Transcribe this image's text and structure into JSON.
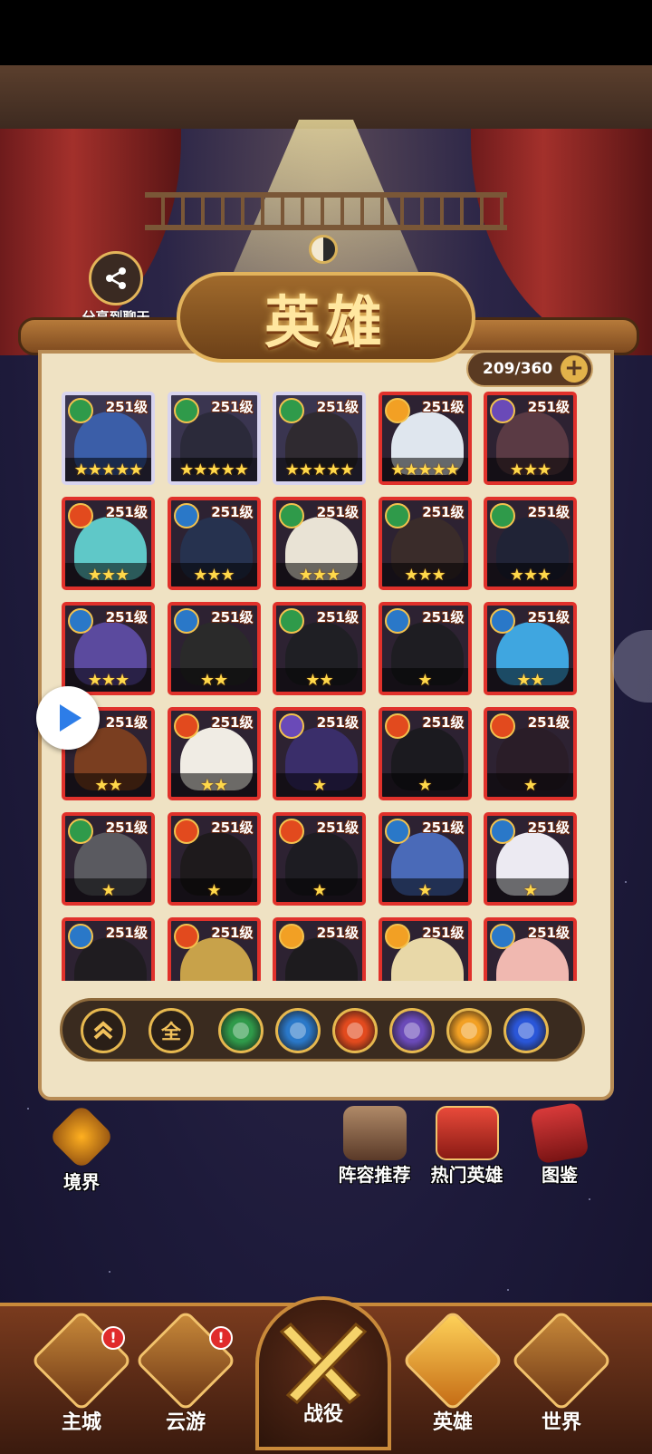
{
  "share": {
    "label": "分享到聊天",
    "icon": "share-icon"
  },
  "header": {
    "title": "英雄"
  },
  "counter": {
    "text": "209/360",
    "plus_label": "+"
  },
  "heroes": [
    {
      "level": "251级",
      "element": "wood",
      "stars": "★★★★★",
      "frame": "platinum",
      "face": "#3b5ea8"
    },
    {
      "level": "251级",
      "element": "wood",
      "stars": "★★★★★",
      "frame": "platinum",
      "face": "#2b2a3a"
    },
    {
      "level": "251级",
      "element": "wood",
      "stars": "★★★★★",
      "frame": "platinum",
      "face": "#2f2a30"
    },
    {
      "level": "251级",
      "element": "light",
      "stars": "★★★★★",
      "frame": "red",
      "face": "#dfe6ee"
    },
    {
      "level": "251级",
      "element": "moon",
      "stars": "★★★",
      "frame": "red",
      "face": "#5a3a44"
    },
    {
      "level": "251级",
      "element": "fire",
      "stars": "★★★",
      "frame": "red",
      "face": "#5fc8c8"
    },
    {
      "level": "251级",
      "element": "water",
      "stars": "★★★",
      "frame": "red",
      "face": "#26324f"
    },
    {
      "level": "251级",
      "element": "wood",
      "stars": "★★★",
      "frame": "red",
      "face": "#e9e3d5"
    },
    {
      "level": "251级",
      "element": "wood",
      "stars": "★★★",
      "frame": "red",
      "face": "#3a2c2a"
    },
    {
      "level": "251级",
      "element": "wood",
      "stars": "★★★",
      "frame": "red",
      "face": "#202336"
    },
    {
      "level": "251级",
      "element": "water",
      "stars": "★★★",
      "frame": "red",
      "face": "#5b4a9e"
    },
    {
      "level": "251级",
      "element": "water",
      "stars": "★★",
      "frame": "red",
      "face": "#2a2a2a"
    },
    {
      "level": "251级",
      "element": "wood",
      "stars": "★★",
      "frame": "red",
      "face": "#1f1f24"
    },
    {
      "level": "251级",
      "element": "water",
      "stars": "★",
      "frame": "red",
      "face": "#1e1d22"
    },
    {
      "level": "251级",
      "element": "water",
      "stars": "★★",
      "frame": "red",
      "face": "#3fa6e0"
    },
    {
      "level": "251级",
      "element": "fire",
      "stars": "★★",
      "frame": "red",
      "face": "#7a3e20"
    },
    {
      "level": "251级",
      "element": "fire",
      "stars": "★★",
      "frame": "red",
      "face": "#f0ece4"
    },
    {
      "level": "251级",
      "element": "moon",
      "stars": "★",
      "frame": "red",
      "face": "#3a2e6a"
    },
    {
      "level": "251级",
      "element": "fire",
      "stars": "★",
      "frame": "red",
      "face": "#1b1a1f"
    },
    {
      "level": "251级",
      "element": "fire",
      "stars": "★",
      "frame": "red",
      "face": "#2a1d28"
    },
    {
      "level": "251级",
      "element": "wood",
      "stars": "★",
      "frame": "red",
      "face": "#5a5a60"
    },
    {
      "level": "251级",
      "element": "fire",
      "stars": "★",
      "frame": "red",
      "face": "#1e1a1c"
    },
    {
      "level": "251级",
      "element": "fire",
      "stars": "★",
      "frame": "red",
      "face": "#1d1c22"
    },
    {
      "level": "251级",
      "element": "water",
      "stars": "★",
      "frame": "red",
      "face": "#4a6ab8"
    },
    {
      "level": "251级",
      "element": "water",
      "stars": "★",
      "frame": "red",
      "face": "#eceaf2"
    },
    {
      "level": "251级",
      "element": "water",
      "stars": "",
      "frame": "red",
      "face": "#1f1c20"
    },
    {
      "level": "251级",
      "element": "fire",
      "stars": "",
      "frame": "red",
      "face": "#c8a24a"
    },
    {
      "level": "251级",
      "element": "light",
      "stars": "",
      "frame": "red",
      "face": "#1d1b1e"
    },
    {
      "level": "251级",
      "element": "light",
      "stars": "",
      "frame": "red",
      "face": "#e8d8a8"
    },
    {
      "level": "251级",
      "element": "water",
      "stars": "",
      "frame": "red",
      "face": "#f0b8b0"
    }
  ],
  "colors": {
    "wood": "#2f9a4a",
    "water": "#2a78c8",
    "fire": "#e24a1e",
    "moon": "#6a4ab8",
    "light": "#f2a024",
    "vortex": "#2a56d8"
  },
  "filters": {
    "up_icon": "double-chevron-up-icon",
    "all_label": "全",
    "elements": [
      "wood",
      "water",
      "fire",
      "moon",
      "light",
      "vortex"
    ]
  },
  "side_buttons": {
    "realm": "境界",
    "lineup": "阵容推荐",
    "hot": "热门英雄",
    "atlas": "图鉴"
  },
  "nav": {
    "main_city": "主城",
    "travel": "云游",
    "battle": "战役",
    "heroes": "英雄",
    "world": "世界",
    "badge_text": "!"
  }
}
